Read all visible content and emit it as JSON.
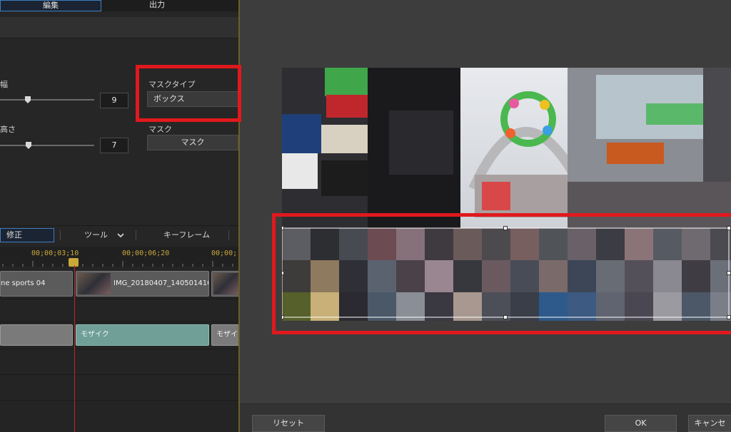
{
  "tabs": {
    "edit": "編集",
    "output": "出力"
  },
  "params": {
    "width_label": "幅",
    "width_value": "9",
    "height_label": "高さ",
    "height_value": "7"
  },
  "mask": {
    "type_label": "マスクタイプ",
    "type_value": "ボックス",
    "mask_label": "マスク",
    "mask_button": "マスク"
  },
  "toolbar": {
    "fix": "修正",
    "tool": "ツール",
    "keyframe": "キーフレーム"
  },
  "ruler": {
    "t1": "00;00;03;10",
    "t2": "00;00;06;20",
    "t3": "00;00;"
  },
  "clips": {
    "c1": "ne sports 04",
    "c2": "IMG_20180407_140501410"
  },
  "effects": {
    "e1": "モザイク",
    "e2": "モザイク"
  },
  "dialog": {
    "reset": "リセット",
    "ok": "OK",
    "cancel": "キャンセ"
  },
  "colors": {
    "highlight_red": "#e0191d",
    "effect_teal": "#6f9f97",
    "playhead": "#c0272d",
    "timecode": "#c9a83a"
  }
}
